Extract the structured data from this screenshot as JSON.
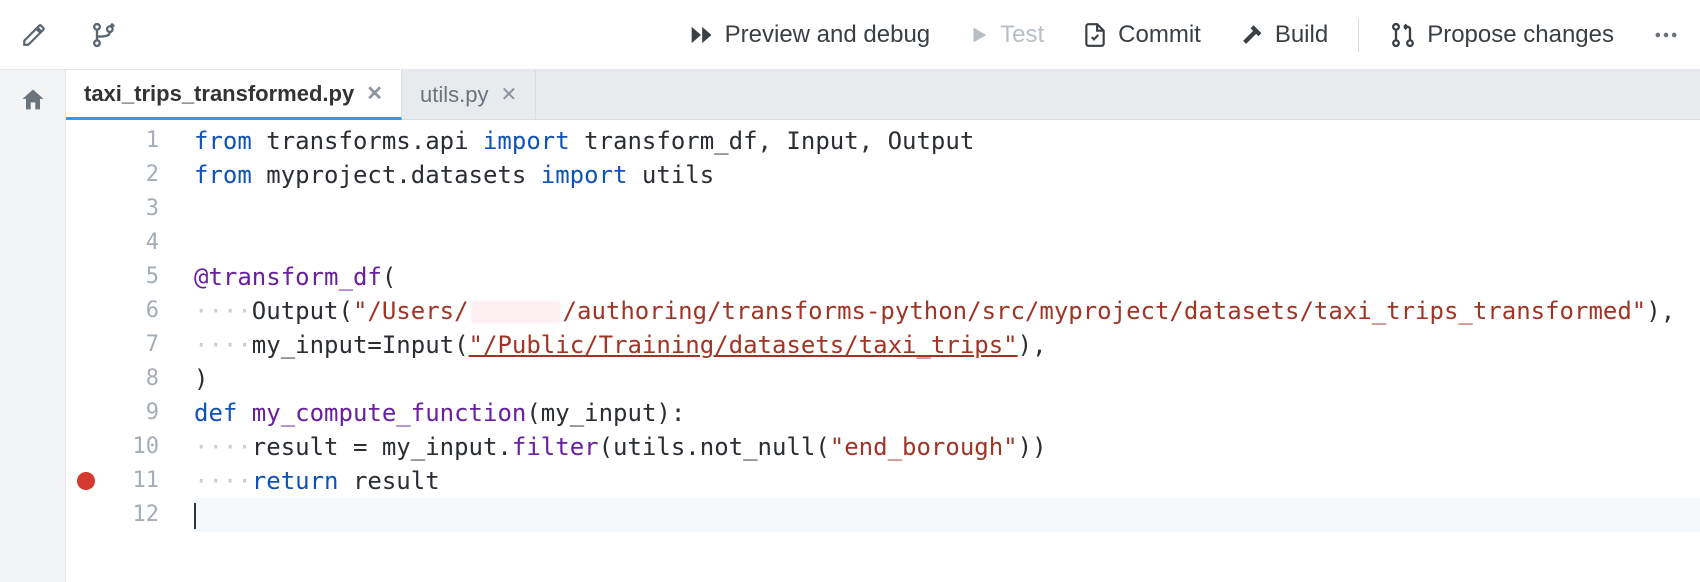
{
  "toolbar": {
    "preview_label": "Preview and debug",
    "test_label": "Test",
    "commit_label": "Commit",
    "build_label": "Build",
    "propose_label": "Propose changes"
  },
  "tabs": [
    {
      "label": "taxi_trips_transformed.py",
      "active": true
    },
    {
      "label": "utils.py",
      "active": false
    }
  ],
  "code": {
    "lines": [
      {
        "n": 1,
        "bp": false
      },
      {
        "n": 2,
        "bp": false
      },
      {
        "n": 3,
        "bp": false
      },
      {
        "n": 4,
        "bp": false
      },
      {
        "n": 5,
        "bp": false
      },
      {
        "n": 6,
        "bp": false
      },
      {
        "n": 7,
        "bp": false
      },
      {
        "n": 8,
        "bp": false
      },
      {
        "n": 9,
        "bp": false
      },
      {
        "n": 10,
        "bp": false
      },
      {
        "n": 11,
        "bp": true
      },
      {
        "n": 12,
        "bp": false
      }
    ],
    "l1_from": "from",
    "l1_mod": " transforms.api ",
    "l1_import": "import",
    "l1_rest": " transform_df, Input, Output",
    "l2_from": "from",
    "l2_mod": " myproject.datasets ",
    "l2_import": "import",
    "l2_rest": " utils",
    "l5_dec": "@transform_df",
    "l5_paren": "(",
    "ws4": "····",
    "l6_a": "Output(",
    "l6_s1": "\"/Users/",
    "l6_s2": "/authoring/transforms-python/src/myproject/datasets/taxi_trips_transformed\"",
    "l6_end": "),",
    "l7_a": "my_input=Input(",
    "l7_s": "\"/Public/Training/datasets/taxi_trips\"",
    "l7_end": "),",
    "l8": ")",
    "l9_def": "def",
    "l9_name": " my_compute_function",
    "l9_sig": "(my_input):",
    "l10_a": "result = my_input.",
    "l10_fn": "filter",
    "l10_b": "(utils.not_null(",
    "l10_s": "\"end_borough\"",
    "l10_c": "))",
    "l11_ret": "return",
    "l11_rest": " result"
  }
}
